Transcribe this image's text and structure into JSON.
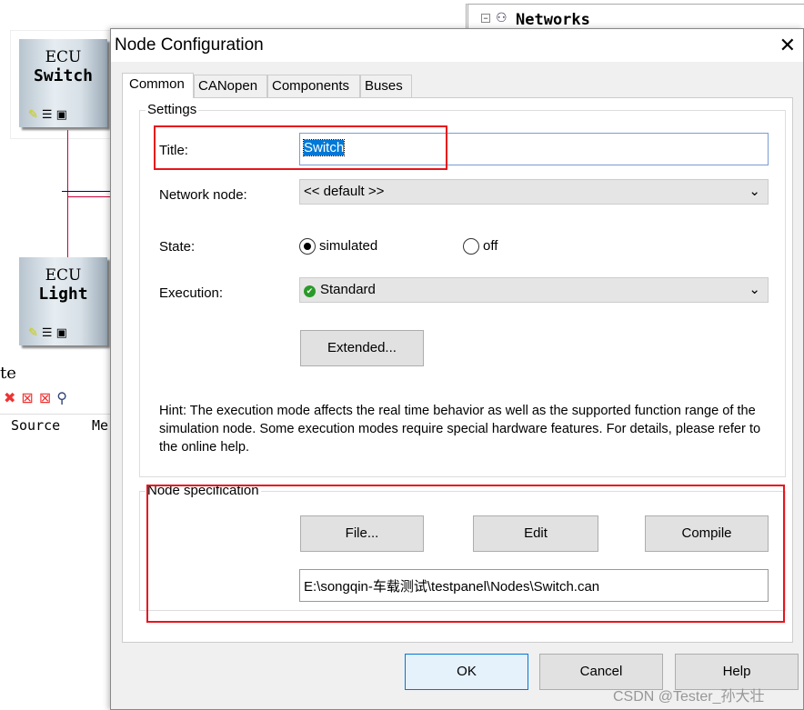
{
  "background": {
    "networks_label": "Networks",
    "ecu_nodes": [
      {
        "line1": "ECU",
        "line2": "Switch"
      },
      {
        "line1": "ECU",
        "line2": "Light"
      }
    ],
    "partial_label": "te",
    "columns": [
      "Source",
      "Me"
    ]
  },
  "dialog": {
    "title": "Node Configuration",
    "tabs": [
      "Common",
      "CANopen",
      "Components",
      "Buses"
    ],
    "settings": {
      "group_label": "Settings",
      "title_label": "Title:",
      "title_value": "Switch",
      "network_node_label": "Network node:",
      "network_node_value": "<< default >>",
      "state_label": "State:",
      "state_options": [
        "simulated",
        "off"
      ],
      "state_selected": "simulated",
      "execution_label": "Execution:",
      "execution_value": "Standard",
      "extended_button": "Extended...",
      "hint": "Hint: The execution mode affects the real time behavior as well as the supported function range of the simulation node. Some execution modes require special hardware features. For details, please refer to the online help."
    },
    "node_spec": {
      "group_label": "Node specification",
      "file_button": "File...",
      "edit_button": "Edit",
      "compile_button": "Compile",
      "path": "E:\\songqin-车载测试\\testpanel\\Nodes\\Switch.can"
    },
    "buttons": {
      "ok": "OK",
      "cancel": "Cancel",
      "help": "Help"
    }
  },
  "watermark": "CSDN @Tester_孙大壮",
  "colors": {
    "highlight": "#e8141c",
    "selection": "#0078d7",
    "bus_line": "#c8003c"
  }
}
